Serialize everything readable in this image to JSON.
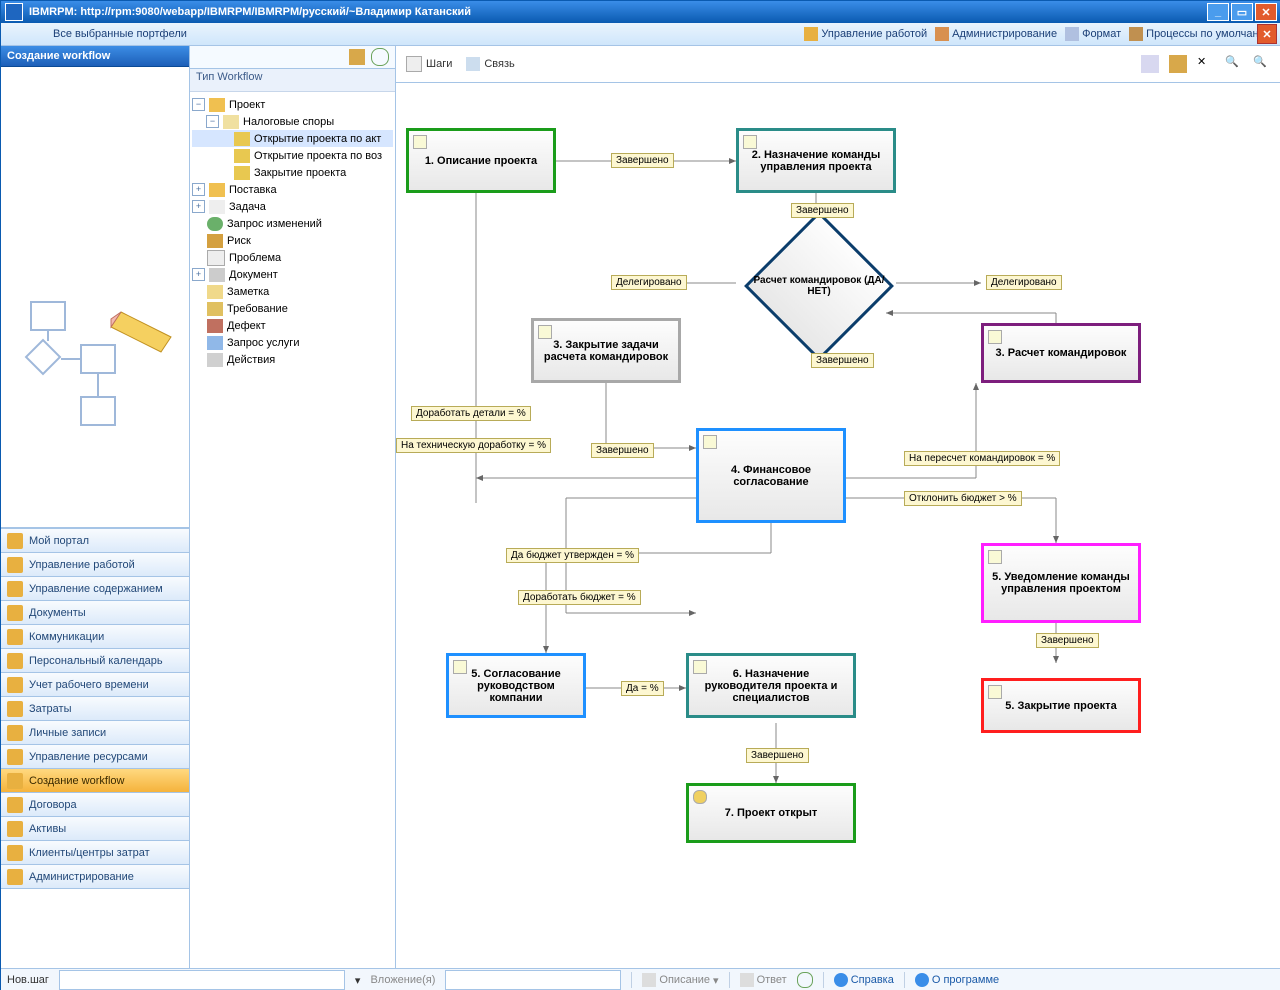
{
  "title": "IBMRPM: http://rpm:9080/webapp/IBMRPM/IBMRPM/русский/~Владимир Катанский",
  "menubar": {
    "left": "Все выбранные портфели",
    "links": [
      "Управление работой",
      "Администрирование",
      "Формат",
      "Процессы по умолчанию"
    ]
  },
  "nav_header": "Создание workflow",
  "tree_header": "Тип Workflow",
  "tree": {
    "root": "Проект",
    "child1": "Налоговые споры",
    "leaves": [
      "Открытие проекта по акт",
      "Открытие проекта по воз",
      "Закрытие проекта"
    ],
    "siblings": [
      "Поставка",
      "Задача",
      "Запрос изменений",
      "Риск",
      "Проблема",
      "Документ",
      "Заметка",
      "Требование",
      "Дефект",
      "Запрос услуги",
      "Действия"
    ]
  },
  "nav_items": [
    "Мой портал",
    "Управление работой",
    "Управление содержанием",
    "Документы",
    "Коммуникации",
    "Персональный календарь",
    "Учет рабочего времени",
    "Затраты",
    "Личные записи",
    "Управление ресурсами",
    "Создание workflow",
    "Договора",
    "Активы",
    "Клиенты/центры затрат",
    "Администрирование"
  ],
  "canvas_tb": {
    "steps": "Шаги",
    "link": "Связь"
  },
  "nodes": {
    "n1": "1. Описание проекта",
    "n2": "2. Назначение команды управления проекта",
    "d1": "Расчет командировок (ДА/НЕТ)",
    "n3a": "3. Закрытие задачи расчета командировок",
    "n3b": "3. Расчет командировок",
    "n4": "4. Финансовое согласование",
    "n5a": "5. Согласование руководством компании",
    "n5b": "5. Уведомление команды управления проектом",
    "n5c": "5. Закрытие проекта",
    "n6": "6. Назначение руководителя проекта и специалистов",
    "n7": "7. Проект открыт"
  },
  "edges": {
    "e1": "Завершено",
    "e2": "Завершено",
    "e3": "Делегировано",
    "e4": "Делегировано",
    "e5": "Завершено",
    "e6": "Доработать детали = %",
    "e7": "На техническую доработку = %",
    "e8": "Завершено",
    "e9": "На пересчет командировок = %",
    "e10": "Отклонить бюджет > %",
    "e11": "Да бюджет утвержден = %",
    "e12": "Доработать бюджет = %",
    "e13": "Да = %",
    "e14": "Завершено",
    "e15": "Завершено"
  },
  "footer": {
    "novstep": "Нов.шаг",
    "attach": "Вложение(я)",
    "desc": "Описание",
    "answer": "Ответ",
    "help": "Справка",
    "about": "О программе"
  }
}
